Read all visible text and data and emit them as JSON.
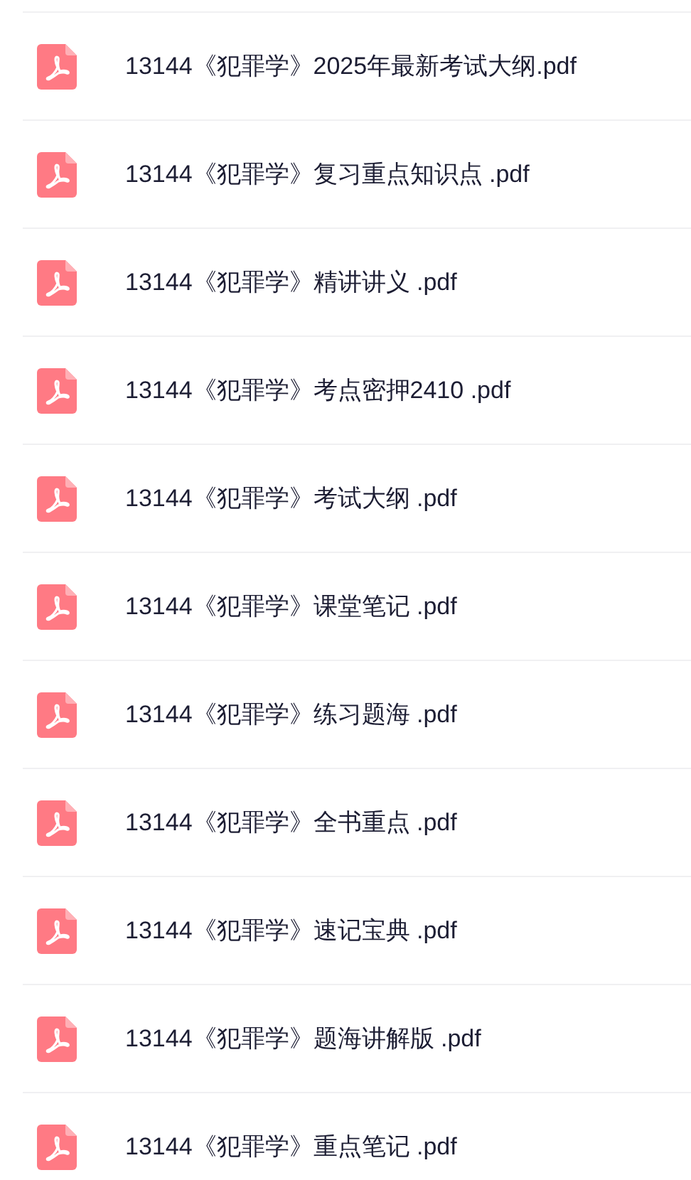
{
  "files": [
    {
      "name": "13144《犯罪学》2025年最新考试大纲.pdf"
    },
    {
      "name": "13144《犯罪学》复习重点知识点 .pdf"
    },
    {
      "name": "13144《犯罪学》精讲讲义 .pdf"
    },
    {
      "name": "13144《犯罪学》考点密押2410 .pdf"
    },
    {
      "name": "13144《犯罪学》考试大纲 .pdf"
    },
    {
      "name": "13144《犯罪学》课堂笔记 .pdf"
    },
    {
      "name": "13144《犯罪学》练习题海 .pdf"
    },
    {
      "name": "13144《犯罪学》全书重点 .pdf"
    },
    {
      "name": "13144《犯罪学》速记宝典 .pdf"
    },
    {
      "name": "13144《犯罪学》题海讲解版 .pdf"
    },
    {
      "name": "13144《犯罪学》重点笔记 .pdf"
    }
  ]
}
